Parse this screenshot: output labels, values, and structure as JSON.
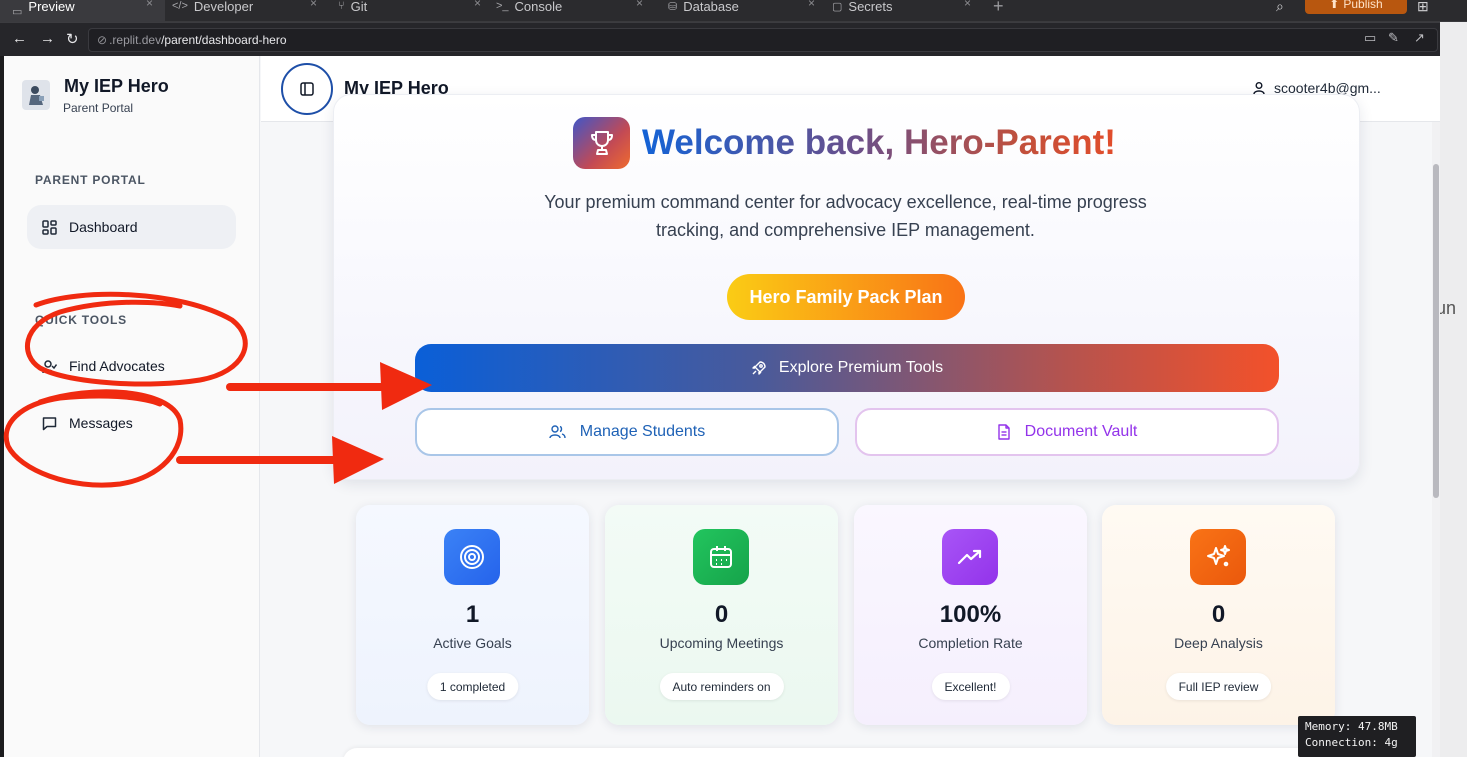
{
  "ide_tabs": [
    {
      "label": "Preview",
      "icon": "monitor-icon"
    },
    {
      "label": "Developer",
      "icon": "code-icon"
    },
    {
      "label": "Git",
      "icon": "git-icon"
    },
    {
      "label": "Console",
      "icon": "terminal-icon"
    },
    {
      "label": "Database",
      "icon": "database-icon"
    },
    {
      "label": "Secrets",
      "icon": "lock-icon"
    }
  ],
  "publish_label": "Publish",
  "browser": {
    "url_host": ".replit.dev",
    "url_path": "/parent/dashboard-hero"
  },
  "sidebar": {
    "brand_title": "My IEP Hero",
    "brand_subtitle": "Parent Portal",
    "section_parent": "PARENT PORTAL",
    "dashboard_label": "Dashboard",
    "section_quick": "QUICK TOOLS",
    "find_advocates_label": "Find Advocates",
    "messages_label": "Messages"
  },
  "header": {
    "title": "My IEP Hero",
    "user_email": "scooter4b@gm..."
  },
  "hero": {
    "welcome": "Welcome back, Hero-Parent!",
    "description": "Your premium command center for advocacy excellence, real-time progress tracking, and comprehensive IEP management.",
    "plan_label": "Hero Family Pack Plan",
    "explore_label": "Explore Premium Tools",
    "manage_students_label": "Manage Students",
    "document_vault_label": "Document Vault"
  },
  "stats": [
    {
      "value": "1",
      "label": "Active Goals",
      "pill": "1 completed",
      "icon": "target-icon"
    },
    {
      "value": "0",
      "label": "Upcoming Meetings",
      "pill": "Auto reminders on",
      "icon": "calendar-icon"
    },
    {
      "value": "100%",
      "label": "Completion Rate",
      "pill": "Excellent!",
      "icon": "trending-up-icon"
    },
    {
      "value": "0",
      "label": "Deep Analysis",
      "pill": "Full IEP review",
      "icon": "sparkles-icon"
    }
  ],
  "debug": {
    "memory": "Memory: 47.8MB",
    "connection": "Connection: 4g"
  },
  "right_strip_text": "un",
  "colors": {
    "annotation_red": "#f02a10",
    "accent_blue": "#1463d6",
    "accent_orange": "#f97316"
  }
}
